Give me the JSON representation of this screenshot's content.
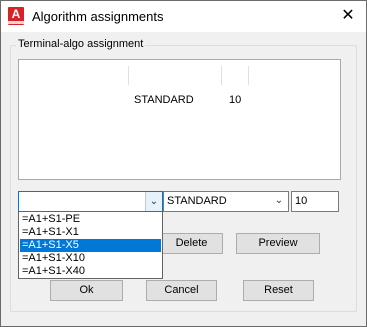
{
  "window": {
    "title": "Algorithm assignments",
    "close_symbol": "✕",
    "app_icon_letter": "A"
  },
  "group": {
    "label": "Terminal-algo assignment"
  },
  "list": {
    "rows": [
      {
        "algo": "STANDARD",
        "value": "10"
      }
    ]
  },
  "inputs": {
    "terminal_combo_value": "",
    "algo_combo_value": "STANDARD",
    "value_field": "10",
    "dropdown_arrow": "⌄"
  },
  "dropdown": {
    "items": [
      "=A1+S1-PE",
      "=A1+S1-X1",
      "=A1+S1-X5",
      "=A1+S1-X10",
      "=A1+S1-X40"
    ],
    "selected_index": 2
  },
  "buttons": {
    "delete": "Delete",
    "preview": "Preview",
    "ok": "Ok",
    "cancel": "Cancel",
    "reset": "Reset"
  }
}
